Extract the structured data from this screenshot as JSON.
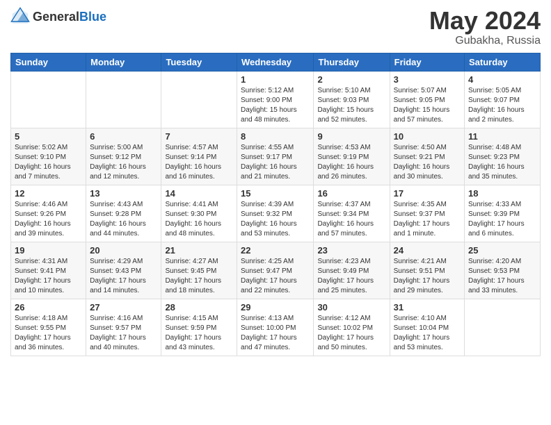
{
  "header": {
    "logo_general": "General",
    "logo_blue": "Blue",
    "title": "May 2024",
    "subtitle": "Gubakha, Russia"
  },
  "weekdays": [
    "Sunday",
    "Monday",
    "Tuesday",
    "Wednesday",
    "Thursday",
    "Friday",
    "Saturday"
  ],
  "weeks": [
    [
      {
        "day": "",
        "info": ""
      },
      {
        "day": "",
        "info": ""
      },
      {
        "day": "",
        "info": ""
      },
      {
        "day": "1",
        "info": "Sunrise: 5:12 AM\nSunset: 9:00 PM\nDaylight: 15 hours\nand 48 minutes."
      },
      {
        "day": "2",
        "info": "Sunrise: 5:10 AM\nSunset: 9:03 PM\nDaylight: 15 hours\nand 52 minutes."
      },
      {
        "day": "3",
        "info": "Sunrise: 5:07 AM\nSunset: 9:05 PM\nDaylight: 15 hours\nand 57 minutes."
      },
      {
        "day": "4",
        "info": "Sunrise: 5:05 AM\nSunset: 9:07 PM\nDaylight: 16 hours\nand 2 minutes."
      }
    ],
    [
      {
        "day": "5",
        "info": "Sunrise: 5:02 AM\nSunset: 9:10 PM\nDaylight: 16 hours\nand 7 minutes."
      },
      {
        "day": "6",
        "info": "Sunrise: 5:00 AM\nSunset: 9:12 PM\nDaylight: 16 hours\nand 12 minutes."
      },
      {
        "day": "7",
        "info": "Sunrise: 4:57 AM\nSunset: 9:14 PM\nDaylight: 16 hours\nand 16 minutes."
      },
      {
        "day": "8",
        "info": "Sunrise: 4:55 AM\nSunset: 9:17 PM\nDaylight: 16 hours\nand 21 minutes."
      },
      {
        "day": "9",
        "info": "Sunrise: 4:53 AM\nSunset: 9:19 PM\nDaylight: 16 hours\nand 26 minutes."
      },
      {
        "day": "10",
        "info": "Sunrise: 4:50 AM\nSunset: 9:21 PM\nDaylight: 16 hours\nand 30 minutes."
      },
      {
        "day": "11",
        "info": "Sunrise: 4:48 AM\nSunset: 9:23 PM\nDaylight: 16 hours\nand 35 minutes."
      }
    ],
    [
      {
        "day": "12",
        "info": "Sunrise: 4:46 AM\nSunset: 9:26 PM\nDaylight: 16 hours\nand 39 minutes."
      },
      {
        "day": "13",
        "info": "Sunrise: 4:43 AM\nSunset: 9:28 PM\nDaylight: 16 hours\nand 44 minutes."
      },
      {
        "day": "14",
        "info": "Sunrise: 4:41 AM\nSunset: 9:30 PM\nDaylight: 16 hours\nand 48 minutes."
      },
      {
        "day": "15",
        "info": "Sunrise: 4:39 AM\nSunset: 9:32 PM\nDaylight: 16 hours\nand 53 minutes."
      },
      {
        "day": "16",
        "info": "Sunrise: 4:37 AM\nSunset: 9:34 PM\nDaylight: 16 hours\nand 57 minutes."
      },
      {
        "day": "17",
        "info": "Sunrise: 4:35 AM\nSunset: 9:37 PM\nDaylight: 17 hours\nand 1 minute."
      },
      {
        "day": "18",
        "info": "Sunrise: 4:33 AM\nSunset: 9:39 PM\nDaylight: 17 hours\nand 6 minutes."
      }
    ],
    [
      {
        "day": "19",
        "info": "Sunrise: 4:31 AM\nSunset: 9:41 PM\nDaylight: 17 hours\nand 10 minutes."
      },
      {
        "day": "20",
        "info": "Sunrise: 4:29 AM\nSunset: 9:43 PM\nDaylight: 17 hours\nand 14 minutes."
      },
      {
        "day": "21",
        "info": "Sunrise: 4:27 AM\nSunset: 9:45 PM\nDaylight: 17 hours\nand 18 minutes."
      },
      {
        "day": "22",
        "info": "Sunrise: 4:25 AM\nSunset: 9:47 PM\nDaylight: 17 hours\nand 22 minutes."
      },
      {
        "day": "23",
        "info": "Sunrise: 4:23 AM\nSunset: 9:49 PM\nDaylight: 17 hours\nand 25 minutes."
      },
      {
        "day": "24",
        "info": "Sunrise: 4:21 AM\nSunset: 9:51 PM\nDaylight: 17 hours\nand 29 minutes."
      },
      {
        "day": "25",
        "info": "Sunrise: 4:20 AM\nSunset: 9:53 PM\nDaylight: 17 hours\nand 33 minutes."
      }
    ],
    [
      {
        "day": "26",
        "info": "Sunrise: 4:18 AM\nSunset: 9:55 PM\nDaylight: 17 hours\nand 36 minutes."
      },
      {
        "day": "27",
        "info": "Sunrise: 4:16 AM\nSunset: 9:57 PM\nDaylight: 17 hours\nand 40 minutes."
      },
      {
        "day": "28",
        "info": "Sunrise: 4:15 AM\nSunset: 9:59 PM\nDaylight: 17 hours\nand 43 minutes."
      },
      {
        "day": "29",
        "info": "Sunrise: 4:13 AM\nSunset: 10:00 PM\nDaylight: 17 hours\nand 47 minutes."
      },
      {
        "day": "30",
        "info": "Sunrise: 4:12 AM\nSunset: 10:02 PM\nDaylight: 17 hours\nand 50 minutes."
      },
      {
        "day": "31",
        "info": "Sunrise: 4:10 AM\nSunset: 10:04 PM\nDaylight: 17 hours\nand 53 minutes."
      },
      {
        "day": "",
        "info": ""
      }
    ]
  ]
}
